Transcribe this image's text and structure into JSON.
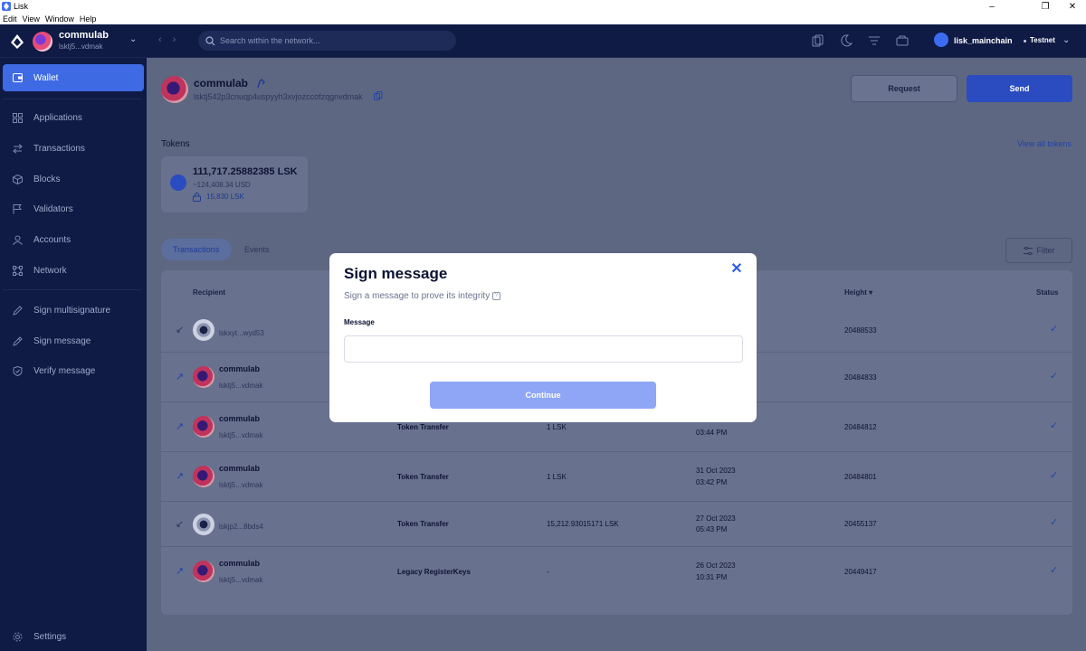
{
  "window": {
    "title": "Lisk",
    "minimize": "–",
    "maximize": "❐",
    "close": "✕"
  },
  "menu": [
    "Edit",
    "View",
    "Window",
    "Help"
  ],
  "account": {
    "name": "commulab",
    "short_address": "lsktj5...vdmak"
  },
  "search": {
    "placeholder": "Search within the network..."
  },
  "network": {
    "chain": "lisk_mainchain",
    "net": "Testnet"
  },
  "sidebar": {
    "items": [
      {
        "label": "Wallet",
        "icon": "wallet-icon",
        "active": true
      },
      {
        "label": "Applications",
        "icon": "grid-icon"
      },
      {
        "label": "Transactions",
        "icon": "swap-icon"
      },
      {
        "label": "Blocks",
        "icon": "cube-icon"
      },
      {
        "label": "Validators",
        "icon": "flag-icon"
      },
      {
        "label": "Accounts",
        "icon": "user-icon"
      },
      {
        "label": "Network",
        "icon": "network-icon"
      },
      {
        "label": "Sign multisignature",
        "icon": "pen-icon"
      },
      {
        "label": "Sign message",
        "icon": "edit-icon"
      },
      {
        "label": "Verify message",
        "icon": "shield-check-icon"
      },
      {
        "label": "Settings",
        "icon": "gear-icon"
      }
    ]
  },
  "profile": {
    "name": "commulab",
    "address": "lsktj542p3cnuqp4uspyyh3xvjozccofzqgnvdmak",
    "request_label": "Request",
    "send_label": "Send"
  },
  "tokens": {
    "title": "Tokens",
    "view_all": "View all tokens",
    "amount": "111,717.25882385 LSK",
    "usd": "~124,408.34 USD",
    "locked": "15,830 LSK"
  },
  "tabs": {
    "transactions": "Transactions",
    "events": "Events",
    "filter": "Filter"
  },
  "table": {
    "headers": {
      "recipient": "Recipient",
      "height": "Height",
      "status": "Status"
    },
    "rows": [
      {
        "direction": "in",
        "name": "",
        "address": "lskxyt...wyd53",
        "type": "",
        "fee": "",
        "date": "",
        "time": "",
        "height": "20488533"
      },
      {
        "direction": "out",
        "name": "commulab",
        "address": "lsktj5...vdmak",
        "type": "",
        "fee": "",
        "date": "",
        "time": "",
        "height": "20484833"
      },
      {
        "direction": "out",
        "name": "commulab",
        "address": "lsktj5...vdmak",
        "type": "Token Transfer",
        "fee": "1 LSK",
        "date": "",
        "time": "03:44 PM",
        "height": "20484812"
      },
      {
        "direction": "out",
        "name": "commulab",
        "address": "lsktj5...vdmak",
        "type": "Token Transfer",
        "fee": "1 LSK",
        "date": "31 Oct 2023",
        "time": "03:42 PM",
        "height": "20484801"
      },
      {
        "direction": "in",
        "name": "",
        "address": "lskjp2...8bds4",
        "type": "Token Transfer",
        "fee": "15,212.93015171 LSK",
        "date": "27 Oct 2023",
        "time": "05:43 PM",
        "height": "20455137"
      },
      {
        "direction": "out",
        "name": "commulab",
        "address": "lsktj5...vdmak",
        "type": "Legacy RegisterKeys",
        "fee": "-",
        "date": "26 Oct 2023",
        "time": "10:31 PM",
        "height": "20449417"
      }
    ]
  },
  "modal": {
    "title": "Sign message",
    "subtitle": "Sign a message to prove its integrity",
    "field_label": "Message",
    "field_value": "",
    "continue_label": "Continue",
    "close": "✕"
  },
  "colors": {
    "accent": "#3e6ae4",
    "sidebar": "#0f1a45",
    "modal_button": "#8ea6f5"
  }
}
